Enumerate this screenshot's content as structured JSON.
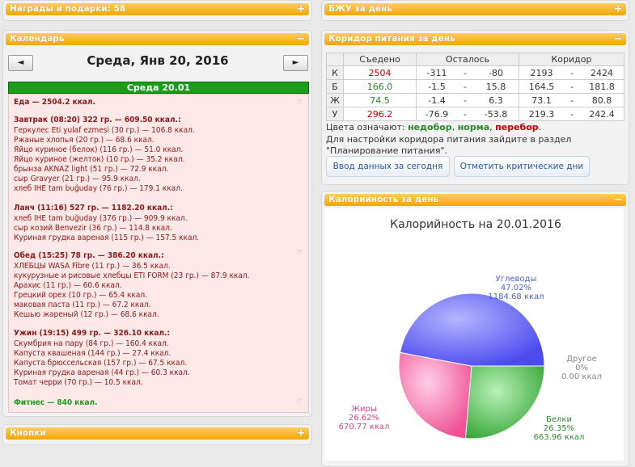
{
  "awards": {
    "title": "Награды и подарки: 58",
    "btn": "+"
  },
  "bju": {
    "title": "БЖУ за день",
    "btn": "+"
  },
  "calendar": {
    "title": "Календарь",
    "btn": "−",
    "prev": "◄",
    "next": "►",
    "date": "Среда, Янв 20, 2016",
    "day_label": "Среда 20.01"
  },
  "food": {
    "total": "Еда — 2504.2 ккал.",
    "meals": [
      {
        "header": "Завтрак (08:20) 322 гр. — 609.50 ккал.:",
        "items": [
          "Геркулес Eti yulaf ezmesi (30 гр.) — 106.8 ккал.",
          "Ржаные хлопья (20 гр.) — 68.6 ккал.",
          "Яйцо куриное (белок) (116 гр.) — 51.0 ккал.",
          "Яйцо куриное (желток) (10 гр.) — 35.2 ккал.",
          "брынза AKNAZ light (51 гр.) — 72.9 ккал.",
          "сыр Gravyer (21 гр.) — 95.9 ккал.",
          "хлеб IHE tam buğuday (76 гр.) — 179.1 ккал."
        ]
      },
      {
        "header": "Ланч (11:16) 527 гр. — 1182.20 ккал.:",
        "items": [
          "хлеб IHE tam buğuday (376 гр.) — 909.9 ккал.",
          "сыр козий Benvezir (36 гр.) — 114.8 ккал.",
          "Куриная грудка вареная (115 гр.) — 157.5 ккал."
        ]
      },
      {
        "header": "Обед (15:25) 78 гр. — 386.20 ккал.:",
        "items": [
          "ХЛЕБЦЫ WASA Fibre (11 гр.) — 36.5 ккал.",
          "кукурузные и рисовые хлебцы ETI FORM (23 гр.) — 87.9 ккал.",
          "Арахис (11 гр.) — 60.6 ккал.",
          "Грецкий орех (10 гр.) — 65.4 ккал.",
          "маковая паста (11 гр.) — 67.2 ккал.",
          "Кешью жареный (12 гр.) — 68.6 ккал."
        ]
      },
      {
        "header": "Ужин (19:15) 499 гр. — 326.10 ккал.:",
        "items": [
          "Скумбрия на пару (84 гр.) — 160.4 ккал.",
          "Капуста квашеная (144 гр.) — 27.4 ккал.",
          "Капуста брюссельская (157 гр.) — 67.5 ккал.",
          "Куриная грудка вареная (44 гр.) — 60.3 ккал.",
          "Томат черри (70 гр.) — 10.5 ккал."
        ]
      }
    ],
    "fitness": "Фитнес — 840 ккал."
  },
  "buttons_widget": {
    "title": "Кнопки",
    "btn": "+"
  },
  "corridor": {
    "title": "Коридор питания за день",
    "btn": "−",
    "headers": [
      "",
      "Съедено",
      "Осталось",
      "Коридор"
    ],
    "rows": [
      {
        "k": "К",
        "eaten": "2504",
        "r1": "-311",
        "r2": "-80",
        "c1": "2193",
        "c2": "2424",
        "color": "#cc0000"
      },
      {
        "k": "Б",
        "eaten": "166.0",
        "r1": "-1.5",
        "r2": "15.8",
        "c1": "164.5",
        "c2": "181.8",
        "color": "#2a8a2a"
      },
      {
        "k": "Ж",
        "eaten": "74.5",
        "r1": "-1.4",
        "r2": "6.3",
        "c1": "73.1",
        "c2": "80.8",
        "color": "#2a8a2a"
      },
      {
        "k": "У",
        "eaten": "296.2",
        "r1": "-76.9",
        "r2": "-53.8",
        "c1": "219.3",
        "c2": "242.4",
        "color": "#cc0000"
      }
    ],
    "dash": "-",
    "legend_prefix": "Цвета означают: ",
    "legend_under": "недобор",
    "legend_norm": "норма",
    "legend_over": "перебор",
    "legend_sep": ", ",
    "legend_end": ".",
    "note1": "Для настройки коридора питания зайдите в раздел",
    "note2": "\"Планирование питания\".",
    "btn_today": "Ввод данных за сегодня",
    "btn_critical": "Отметить критические дни",
    "colors": {
      "under": "#2a8a2a",
      "norm": "#2a8a2a",
      "over": "#cc0000"
    }
  },
  "calories": {
    "title": "Калорийность за день",
    "btn": "−"
  },
  "chart_data": {
    "type": "pie",
    "title": "Калорийность на 20.01.2016",
    "slices": [
      {
        "name": "Углеводы",
        "percent": "47.02%",
        "kcal": "1184.68 ккал",
        "value": 47.02,
        "color": "#6f6ff7",
        "label_color": "#4a63c8"
      },
      {
        "name": "Другое",
        "percent": "0%",
        "kcal": "0.00 ккал",
        "value": 0,
        "color": "#999999",
        "label_color": "#888888"
      },
      {
        "name": "Белки",
        "percent": "26.35%",
        "kcal": "663.96 ккал",
        "value": 26.35,
        "color": "#5cbf5c",
        "label_color": "#2d8a2d"
      },
      {
        "name": "Жиры",
        "percent": "26.62%",
        "kcal": "670.77 ккал",
        "value": 26.62,
        "color": "#f26aa8",
        "label_color": "#d04a8a"
      }
    ]
  }
}
